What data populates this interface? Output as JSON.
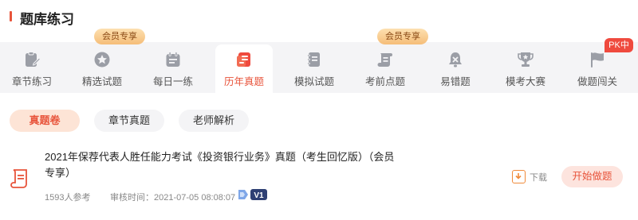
{
  "header": {
    "title": "题库练习"
  },
  "tabs": [
    {
      "label": "章节练习",
      "icon": "clipboard-pen-icon",
      "active": false
    },
    {
      "label": "精选试题",
      "icon": "star-badge-icon",
      "active": false,
      "badge": "会员专享"
    },
    {
      "label": "每日一练",
      "icon": "calendar-icon",
      "active": false
    },
    {
      "label": "历年真题",
      "icon": "exam-paper-icon",
      "active": true
    },
    {
      "label": "模拟试题",
      "icon": "notebook-icon",
      "active": false
    },
    {
      "label": "考前点题",
      "icon": "scroll-icon",
      "active": false,
      "badge": "会员专享"
    },
    {
      "label": "易错题",
      "icon": "alert-bell-icon",
      "active": false
    },
    {
      "label": "模考大赛",
      "icon": "trophy-icon",
      "active": false
    },
    {
      "label": "做题闯关",
      "icon": "flag-icon",
      "active": false,
      "badge": "PK中"
    }
  ],
  "filters": [
    {
      "label": "真题卷",
      "active": true
    },
    {
      "label": "章节真题",
      "active": false
    },
    {
      "label": "老师解析",
      "active": false
    }
  ],
  "paper": {
    "title": "2021年保荐代表人胜任能力考试《投资银行业务》真题（考生回忆版）（会员专享）",
    "participants": "1593人参考",
    "review_time": "审核时间：2021-07-05 08:08:07",
    "vip_badge": "V1",
    "download_label": "下载",
    "start_label": "开始做题"
  },
  "colors": {
    "accent": "#e8543b",
    "member_badge": "#f5bd78",
    "pk_badge": "#ef4a3e",
    "tab_bg": "#f4f4f6"
  }
}
